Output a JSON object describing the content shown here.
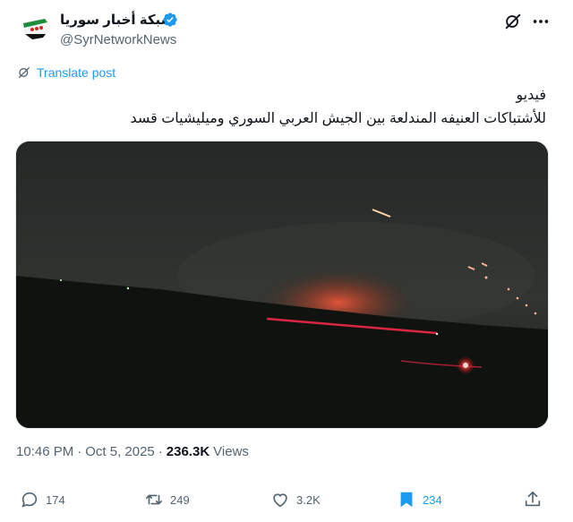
{
  "author": {
    "display_name": "شبكة أخبار سوريا",
    "handle": "@SyrNetworkNews",
    "verified": true,
    "avatar_icon": "syria-flag-map-icon"
  },
  "translate_label": "Translate post",
  "tweet": {
    "line1": "فيديو",
    "line2": "للأشتباكات العنيفه المندلعة بين الجيش العربي السوري  وميليشيات قسد"
  },
  "media": {
    "type": "video",
    "description_icon": "night-clashes-video-icon"
  },
  "meta": {
    "time": "10:46 PM",
    "separator": "·",
    "date": "Oct 5, 2025",
    "views_count": "236.3K",
    "views_label": "Views"
  },
  "actions": {
    "replies": "174",
    "reposts": "249",
    "likes": "3.2K",
    "bookmarks": "234"
  },
  "colors": {
    "accent": "#1d9bf0",
    "text": "#0f1419",
    "muted": "#536471"
  }
}
